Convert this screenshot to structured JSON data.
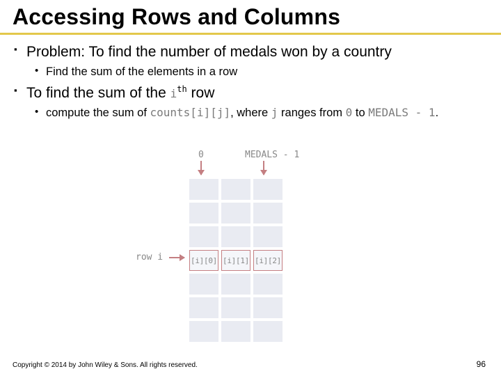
{
  "title": "Accessing Rows and Columns",
  "bullets": {
    "b1": "Problem: To find the number of medals won by a country",
    "b1a": "Find the sum of the elements in a row",
    "b2_pre": "To find the sum of the ",
    "b2_code": "i",
    "b2_sup": "th",
    "b2_post": " row",
    "b2a_pre": "compute the sum of ",
    "b2a_code1": "counts[i][j]",
    "b2a_mid": ", where ",
    "b2a_code2": "j",
    "b2a_mid2": " ranges from ",
    "b2a_code3": "0",
    "b2a_mid3": " to ",
    "b2a_code4": "MEDALS - 1",
    "b2a_end": "."
  },
  "diagram": {
    "col0": "0",
    "colM": "MEDALS - 1",
    "rowLabel": "row i",
    "cells": [
      "[i][0]",
      "[i][1]",
      "[i][2]"
    ]
  },
  "footer": "Copyright © 2014 by John Wiley & Sons. All rights reserved.",
  "page": "96"
}
